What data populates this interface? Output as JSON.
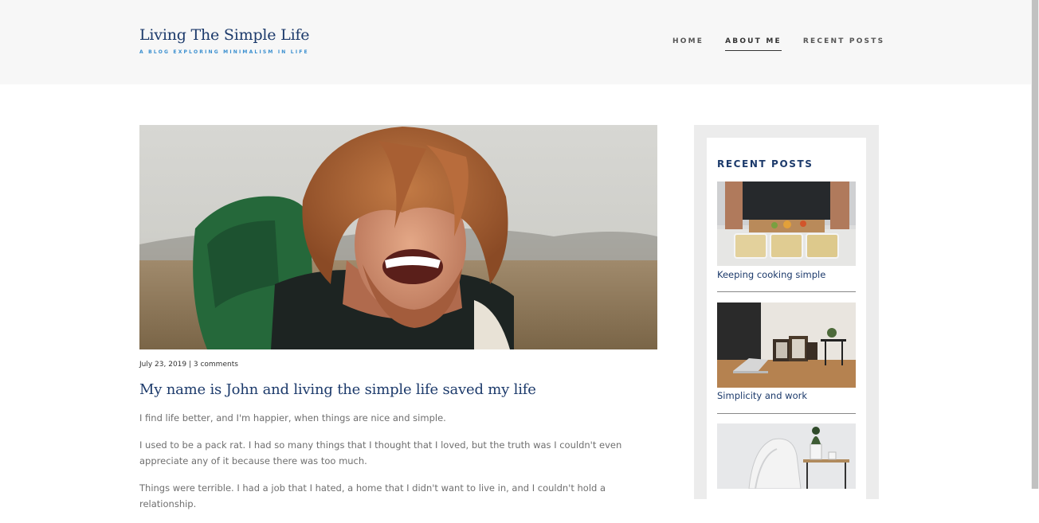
{
  "site": {
    "title": "Living The Simple Life",
    "tagline": "A BLOG EXPLORING MINIMALISM IN LIFE"
  },
  "nav": {
    "items": [
      {
        "label": "HOME",
        "active": false
      },
      {
        "label": "ABOUT ME",
        "active": true
      },
      {
        "label": "RECENT POSTS",
        "active": false
      }
    ]
  },
  "post": {
    "meta": "July 23, 2019 | 3 comments",
    "title": "My name is John and living the simple life saved my life",
    "paragraphs": [
      "I find life better, and I'm happier, when things are nice and simple.",
      "I used to be a pack rat. I had so many things that I thought that I loved, but the truth was I couldn't even appreciate any of it because there was too much.",
      "Things were terrible. I had a job that I hated, a home that I didn't want to live in, and I couldn't hold a relationship."
    ]
  },
  "sidebar": {
    "widget_title": "RECENT POSTS",
    "posts": [
      {
        "label": "Keeping cooking simple"
      },
      {
        "label": "Simplicity and work"
      }
    ]
  },
  "colors": {
    "header_bg": "#f7f7f7",
    "title_navy": "#1c3a6b",
    "tagline_blue": "#3a8fcf",
    "body_gray": "#6f6f6f"
  }
}
